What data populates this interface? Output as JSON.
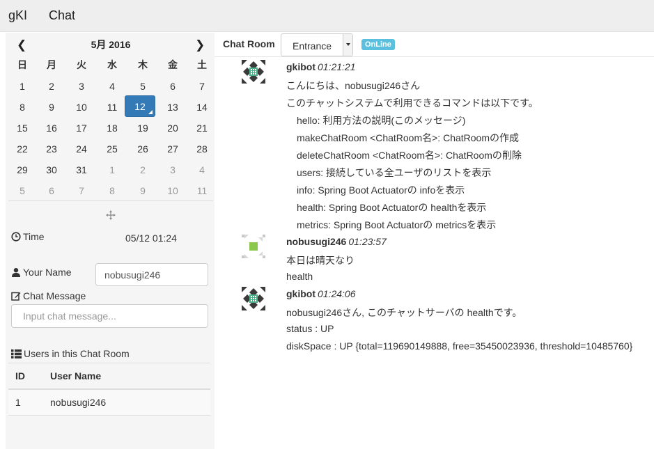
{
  "navbar": {
    "brand": "gKI",
    "chat_link": "Chat"
  },
  "calendar": {
    "title": "5月 2016",
    "weekdays": [
      "日",
      "月",
      "火",
      "水",
      "木",
      "金",
      "土"
    ],
    "weeks": [
      [
        "1",
        "2",
        "3",
        "4",
        "5",
        "6",
        "7"
      ],
      [
        "8",
        "9",
        "10",
        "11",
        "12",
        "13",
        "14"
      ],
      [
        "15",
        "16",
        "17",
        "18",
        "19",
        "20",
        "21"
      ],
      [
        "22",
        "23",
        "24",
        "25",
        "26",
        "27",
        "28"
      ],
      [
        "29",
        "30",
        "31",
        "1",
        "2",
        "3",
        "4"
      ],
      [
        "5",
        "6",
        "7",
        "8",
        "9",
        "10",
        "11"
      ]
    ],
    "selected": "12",
    "accent_color": "#337ab7"
  },
  "time": {
    "label": "Time",
    "value": "05/12 01:24"
  },
  "your_name": {
    "label": "Your Name",
    "value": "nobusugi246"
  },
  "chat_message": {
    "label": "Chat Message",
    "placeholder": "Input chat message..."
  },
  "users": {
    "label": "Users in this Chat Room",
    "columns": [
      "ID",
      "User Name"
    ],
    "rows": [
      [
        "1",
        "nobusugi246"
      ]
    ]
  },
  "room": {
    "label": "Chat Room",
    "selected": "Entrance",
    "status": "OnLine",
    "status_color": "#5bc0de"
  },
  "messages": [
    {
      "user": "gkibot",
      "time": "01:21:21",
      "lines": [
        {
          "text": "こんにちは、nobusugi246さん",
          "indent": false
        },
        {
          "text": "このチャットシステムで利用できるコマンドは以下です。",
          "indent": false
        },
        {
          "text": "hello: 利用方法の説明(このメッセージ)",
          "indent": true
        },
        {
          "text": "makeChatRoom <ChatRoom名>: ChatRoomの作成",
          "indent": true
        },
        {
          "text": "deleteChatRoom <ChatRoom名>: ChatRoomの削除",
          "indent": true
        },
        {
          "text": "users: 接続している全ユーザのリストを表示",
          "indent": true
        },
        {
          "text": "info: Spring Boot Actuatorの infoを表示",
          "indent": true
        },
        {
          "text": "health: Spring Boot Actuatorの healthを表示",
          "indent": true
        },
        {
          "text": "metrics: Spring Boot Actuatorの metricsを表示",
          "indent": true
        }
      ]
    },
    {
      "user": "nobusugi246",
      "time": "01:23:57",
      "lines": [
        {
          "text": "本日は晴天なり",
          "indent": false
        },
        {
          "text": "health",
          "indent": false
        }
      ]
    },
    {
      "user": "gkibot",
      "time": "01:24:06",
      "lines": [
        {
          "text": "nobusugi246さん, このチャットサーバの healthです。",
          "indent": false
        },
        {
          "text": "status : UP",
          "indent": false
        },
        {
          "text": "diskSpace : UP {total=119690149888, free=35450023936, threshold=10485760}",
          "indent": false
        }
      ]
    }
  ]
}
